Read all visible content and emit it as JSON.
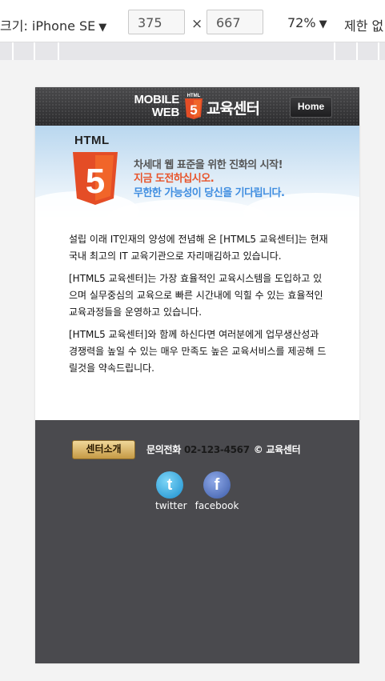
{
  "devtools": {
    "device_label": "크기: iPhone SE",
    "device_caret": "▼",
    "width_value": "375",
    "times_sign": "×",
    "height_value": "667",
    "zoom_label": "72%",
    "zoom_caret": "▼",
    "throttle_label": "제한 없"
  },
  "header": {
    "logo_line1": "MOBILE",
    "logo_line2": "WEB",
    "badge_small": "HTML",
    "badge_number": "5",
    "site_name": "교육센터",
    "home_label": "Home"
  },
  "banner": {
    "html_word": "HTML",
    "shield_number": "5",
    "line1": "차세대 웹 표준을 위한 진화의 시작!",
    "line2": "지금 도전하십시오.",
    "line3": "무한한 가능성이 당신을 기다립니다."
  },
  "content": {
    "paragraphs": [
      "설립 이래 IT인재의 양성에 전념해 온 [HTML5 교육센터]는 현재 국내 최고의 IT 교육기관으로 자리매김하고 있습니다.",
      "[HTML5 교육센터]는 가장 효율적인 교육시스템을 도입하고 있으며 실무중심의 교육으로 빠른 시간내에 익힐 수 있는 효율적인 교육과정들을 운영하고 있습니다.",
      "[HTML5 교육센터]와 함께 하신다면 여러분에게 업무생산성과 경쟁력을 높일 수 있는 매우 만족도 높은 교육서비스를 제공해 드릴것을 약속드립니다."
    ]
  },
  "footer": {
    "intro_button": "센터소개",
    "contact_label": "문의전화",
    "phone": "02-123-4567",
    "copyright": "© 교육센터",
    "twitter_glyph": "t",
    "twitter_label": "twitter",
    "facebook_glyph": "f",
    "facebook_label": "facebook"
  },
  "colors": {
    "html5_orange": "#e44d26",
    "footer_bg": "#4a4a4e",
    "banner_orange_text": "#e8542a",
    "banner_blue_text": "#3f8de0"
  }
}
